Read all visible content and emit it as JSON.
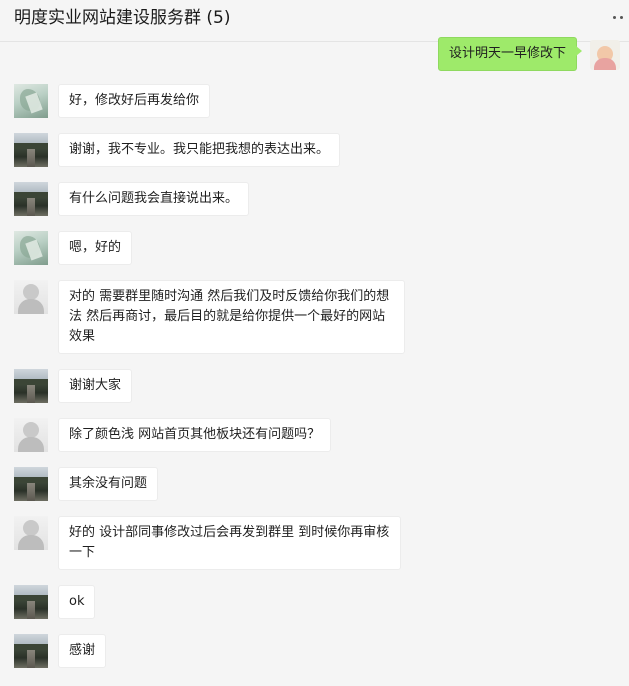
{
  "header": {
    "title": "明度实业网站建设服务群 (5)"
  },
  "messages": [
    {
      "text": "设计明天一早修改下"
    },
    {
      "text": "好，修改好后再发给你"
    },
    {
      "text": "谢谢，我不专业。我只能把我想的表达出来。"
    },
    {
      "text": "有什么问题我会直接说出来。"
    },
    {
      "text": "嗯，好的"
    },
    {
      "text": "对的   需要群里随时沟通  然后我们及时反馈给你我们的想法   然后再商讨，最后目的就是给你提供一个最好的网站效果"
    },
    {
      "text": "谢谢大家"
    },
    {
      "text": "除了颜色浅 网站首页其他板块还有问题吗？"
    },
    {
      "text": "其余没有问题"
    },
    {
      "text": "好的  设计部同事修改过后会再发到群里  到时候你再审核一下"
    },
    {
      "text": "ok"
    },
    {
      "text": "感谢"
    }
  ]
}
